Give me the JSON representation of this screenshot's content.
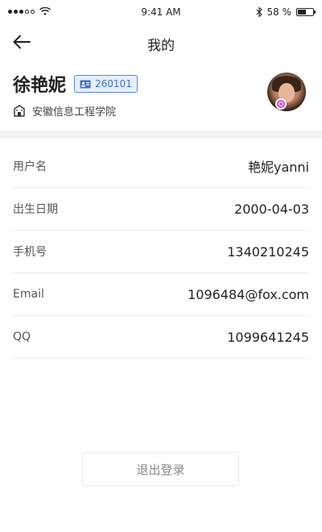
{
  "status_bar": {
    "time": "9:41 AM",
    "battery": "58 %",
    "battery_level": 0.58,
    "icons": [
      "signal-dots-icon",
      "wifi-icon",
      "bluetooth-icon",
      "battery-icon"
    ]
  },
  "nav": {
    "title": "我的",
    "back_icon": "arrow-left-icon"
  },
  "profile": {
    "name": "徐艳妮",
    "id_badge": "260101",
    "school": "安徽信息工程学院",
    "avatar_badge_color": "#d64ad2"
  },
  "info": [
    {
      "label": "用户名",
      "value": "艳妮yanni"
    },
    {
      "label": "出生日期",
      "value": "2000-04-03"
    },
    {
      "label": "手机号",
      "value": "1340210245"
    },
    {
      "label": "Email",
      "value": "1096484@fox.com"
    },
    {
      "label": "QQ",
      "value": "1099641245"
    }
  ],
  "logout": {
    "label": "退出登录"
  },
  "colors": {
    "accent": "#3a6fd8",
    "badge_bg": "#e6efff",
    "divider": "#f2f2f2"
  }
}
